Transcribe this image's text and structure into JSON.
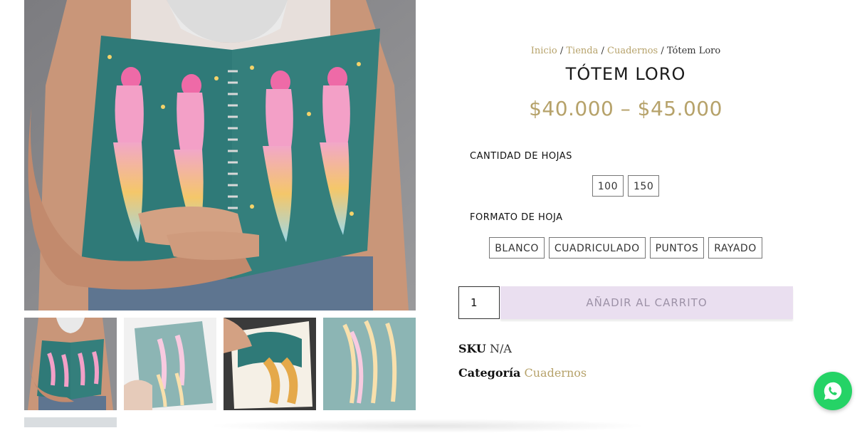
{
  "breadcrumb": {
    "home": "Inicio",
    "shop": "Tienda",
    "category": "Cuadernos",
    "sep": "/",
    "current": "Tótem Loro"
  },
  "product": {
    "title": "TÓTEM LORO",
    "price_range": "$40.000 – $45.000"
  },
  "attributes": {
    "sheets": {
      "label": "CANTIDAD DE HOJAS",
      "options": [
        "100",
        "150"
      ]
    },
    "format": {
      "label": "FORMATO DE HOJA",
      "options": [
        "BLANCO",
        "CUADRICULADO",
        "PUNTOS",
        "RAYADO"
      ]
    }
  },
  "cart": {
    "quantity": "1",
    "add_label": "AÑADIR AL CARRITO"
  },
  "meta": {
    "sku_label": "SKU",
    "sku_value": "N/A",
    "category_label": "Categoría",
    "category_value": "Cuadernos"
  },
  "icons": {
    "whatsapp": "whatsapp-icon"
  },
  "colors": {
    "accent_gold": "#b6a26a",
    "notebook_teal": "#2f7a78",
    "cart_button": "#eadff0",
    "whatsapp_green": "#25d366"
  }
}
